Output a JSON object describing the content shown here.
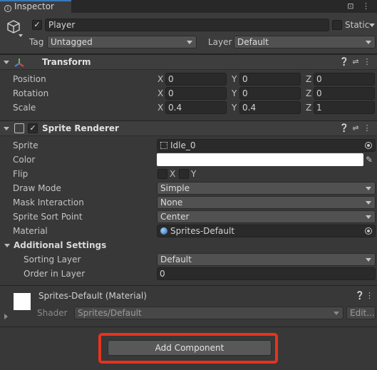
{
  "tab": {
    "label": "Inspector",
    "right_icons": "⊡ ⋮"
  },
  "header": {
    "object_name": "Player",
    "static_label": "Static",
    "tag_label": "Tag",
    "tag_value": "Untagged",
    "layer_label": "Layer",
    "layer_value": "Default"
  },
  "transform": {
    "title": "Transform",
    "rows": [
      {
        "label": "Position",
        "x": "0",
        "y": "0",
        "z": "0"
      },
      {
        "label": "Rotation",
        "x": "0",
        "y": "0",
        "z": "0"
      },
      {
        "label": "Scale",
        "x": "0.4",
        "y": "0.4",
        "z": "1"
      }
    ],
    "axis": {
      "x": "X",
      "y": "Y",
      "z": "Z"
    }
  },
  "sprite_renderer": {
    "title": "Sprite Renderer",
    "sprite_label": "Sprite",
    "sprite_value": "Idle_0",
    "color_label": "Color",
    "color_value": "#ffffff",
    "flip_label": "Flip",
    "flip_x": "X",
    "flip_y": "Y",
    "draw_mode_label": "Draw Mode",
    "draw_mode_value": "Simple",
    "mask_label": "Mask Interaction",
    "mask_value": "None",
    "sort_point_label": "Sprite Sort Point",
    "sort_point_value": "Center",
    "material_label": "Material",
    "material_value": "Sprites-Default",
    "additional_label": "Additional Settings",
    "sorting_layer_label": "Sorting Layer",
    "sorting_layer_value": "Default",
    "order_label": "Order in Layer",
    "order_value": "0"
  },
  "material": {
    "title": "Sprites-Default (Material)",
    "shader_label": "Shader",
    "shader_value": "Sprites/Default",
    "edit_label": "Edit..."
  },
  "add_component_label": "Add Component",
  "colors": {
    "accent": "#3a79bb",
    "highlight": "#e8321c"
  }
}
